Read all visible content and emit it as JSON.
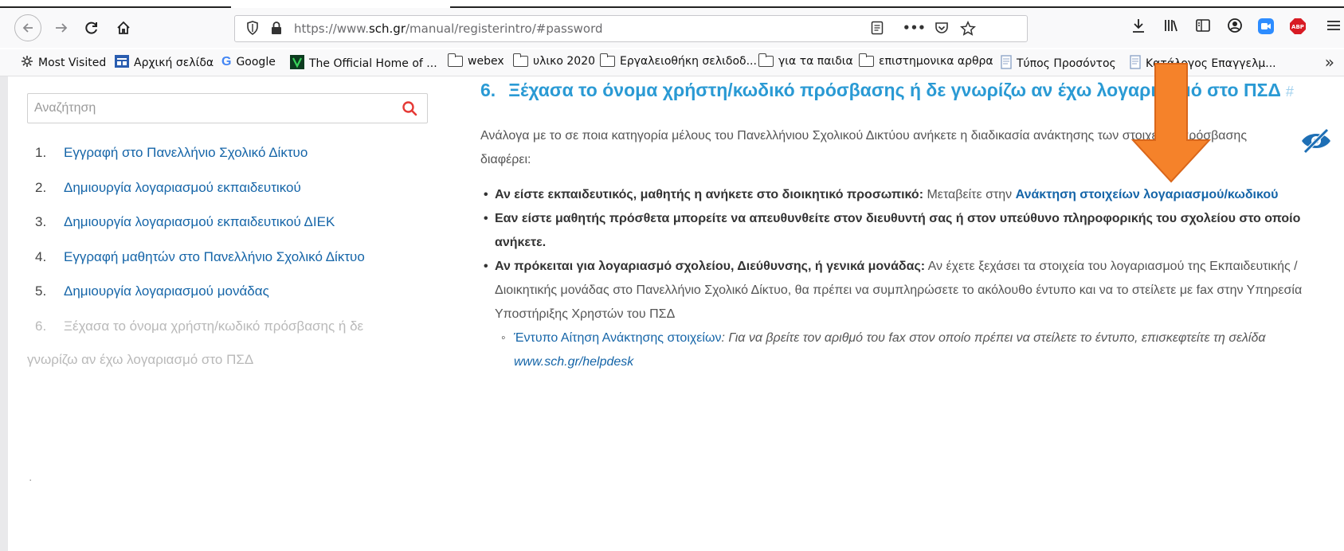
{
  "browser": {
    "url_scheme": "https://www.",
    "url_host": "sch.gr",
    "url_path": "/manual/registerintro/#password",
    "bookmarks": [
      {
        "label": "Most Visited",
        "icon": "gear-icon"
      },
      {
        "label": "Αρχική σελίδα",
        "icon": "homepage-favicon"
      },
      {
        "label": "Google",
        "icon": "google-icon"
      },
      {
        "label": "The Official Home of ...",
        "icon": "site-favicon"
      },
      {
        "label": "webex",
        "icon": "folder-icon"
      },
      {
        "label": "υλικο 2020",
        "icon": "folder-icon"
      },
      {
        "label": "Εργαλειοθήκη σελιδοδ...",
        "icon": "folder-icon"
      },
      {
        "label": "για τα παιδια",
        "icon": "folder-icon"
      },
      {
        "label": "επιστημονικα αρθρα",
        "icon": "folder-icon"
      },
      {
        "label": "Τύπος Προσόντος",
        "icon": "document-icon"
      },
      {
        "label": "Κατάλογος Επαγγελμ...",
        "icon": "document-icon"
      }
    ],
    "more_bookmarks": "»"
  },
  "sidebar": {
    "search_placeholder": "Αναζήτηση",
    "items": [
      {
        "num": "1.",
        "label": "Εγγραφή στο Πανελλήνιο Σχολικό Δίκτυο"
      },
      {
        "num": "2.",
        "label": "Δημιουργία λογαριασμού εκπαιδευτικού"
      },
      {
        "num": "3.",
        "label": "Δημιουργία λογαριασμού εκπαιδευτικού ΔΙΕΚ"
      },
      {
        "num": "4.",
        "label": "Εγγραφή μαθητών στο Πανελλήνιο Σχολικό Δίκτυο"
      },
      {
        "num": "5.",
        "label": "Δημιουργία λογαριασμού μονάδας"
      },
      {
        "num": "6.",
        "label": "Ξέχασα το όνομα χρήστη/κωδικό πρόσβασης ή δε"
      }
    ],
    "current_wrap": "γνωρίζω αν έχω λογαριασμό στο ΠΣΔ",
    "dot": "."
  },
  "main": {
    "heading_num": "6.",
    "heading_text": "Ξέχασα το όνομα χρήστη/κωδικό πρόσβασης ή δε γνωρίζω αν έχω λογαριασμό στο ΠΣΔ",
    "heading_anchor": "#",
    "intro": "Ανάλογα με το σε ποια κατηγορία μέλους του Πανελλήνιου Σχολικού Δικτύου ανήκετε η διαδικασία ανάκτησης των στοιχείων πρόσβασης διαφέρει:",
    "bullet1_bold": "Αν είστε εκπαιδευτικός, μαθητής η ανήκετε στο διοικητικό  προσωπικό:",
    "bullet1_text": " Μεταβείτε στην ",
    "bullet1_link": "Ανάκτηση στοιχείων λογαριασμού/κωδικού",
    "bullet2_bold": "Εαν είστε μαθητής  πρόσθετα μπορείτε να απευθυνθείτε στον διευθυντή σας ή στον υπεύθυνο πληροφορικής του σχολείου στο οποίο ανήκετε.",
    "bullet3_bold": "Αν πρόκειται για λογαριασμό σχολείου, Διεύθυνσης, ή γενικά μονάδας:",
    "bullet3_text": " Αν έχετε ξεχάσει τα στοιχεία του λογαριασμού της Εκπαιδευτικής / Διοικητικής μονάδας στο Πανελλήνιο Σχολικό Δίκτυο, θα πρέπει να συμπληρώσετε το ακόλουθο έντυπο και να το στείλετε με fax στην Υπηρεσία Υποστήριξης Χρηστών του ΠΣΔ",
    "sub_link": "Έντυπο Αίτηση Ανάκτησης στοιχείων",
    "sub_text": ": Για να βρείτε τον αριθμό του fax στον οποίο πρέπει να στείλετε το έντυπο, επισκεφτείτε τη σελίδα ",
    "sub_link2": "www.sch.gr/helpdesk"
  },
  "colors": {
    "heading": "#2a9ad4",
    "link": "#1565a8",
    "arrow": "#f5822a",
    "eye_icon": "#1e6fb5"
  }
}
